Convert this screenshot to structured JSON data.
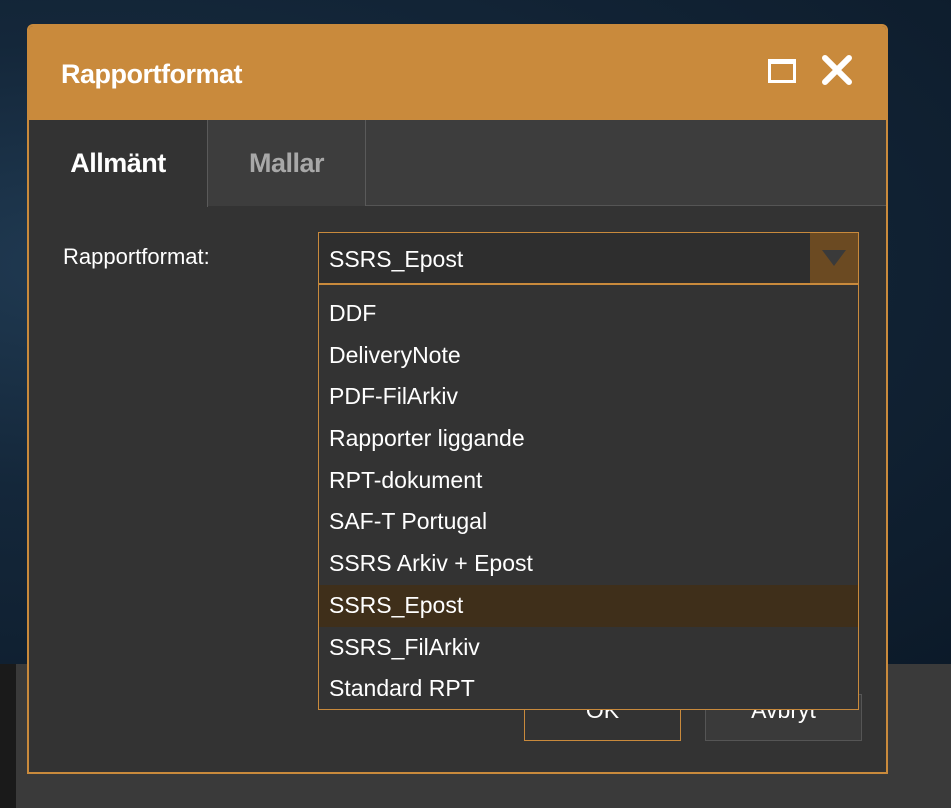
{
  "dialog": {
    "title": "Rapportformat"
  },
  "titlebar": {
    "maximize_icon": "maximize-icon",
    "close_icon": "close-icon"
  },
  "tabs": [
    {
      "label": "Allmänt",
      "active": true
    },
    {
      "label": "Mallar",
      "active": false
    }
  ],
  "form": {
    "format_label": "Rapportformat:",
    "format_value": "SSRS_Epost"
  },
  "dropdown": {
    "options": [
      "DDF",
      "DeliveryNote",
      "PDF-FilArkiv",
      "Rapporter liggande",
      "RPT-dokument",
      "SAF-T Portugal",
      "SSRS Arkiv + Epost",
      "SSRS_Epost",
      "SSRS_FilArkiv",
      "Standard RPT"
    ],
    "selected": "SSRS_Epost"
  },
  "buttons": {
    "ok": "OK",
    "cancel": "Avbryt"
  },
  "colors": {
    "accent": "#c98a3c",
    "dialog_bg": "#333333",
    "selected_option_bg": "#3f2f1a"
  }
}
